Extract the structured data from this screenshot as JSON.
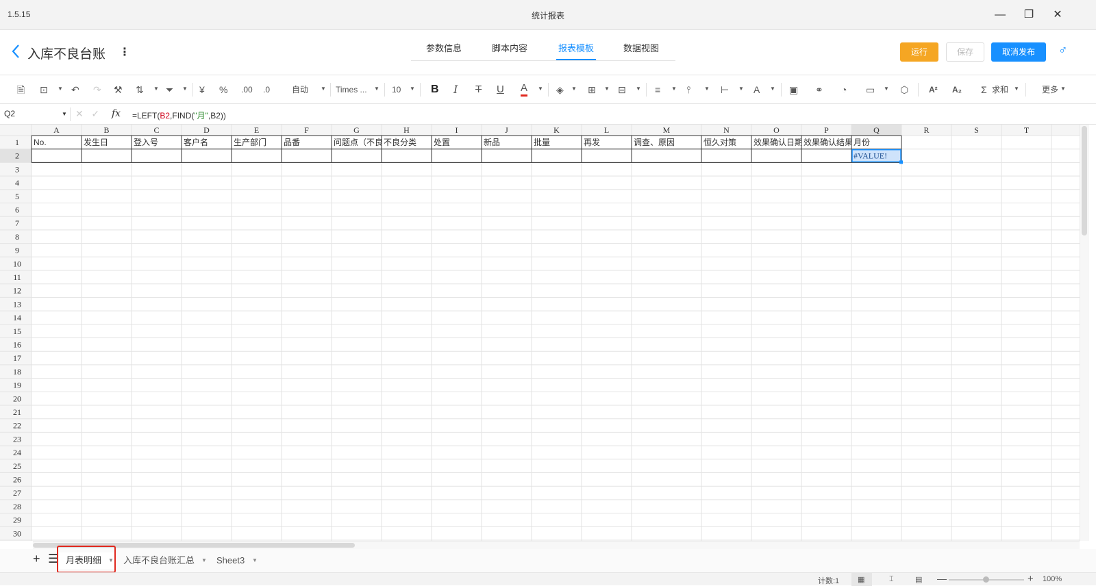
{
  "window": {
    "version": "1.5.15",
    "title": "统计报表",
    "minimize_icon": "minimize-icon",
    "restore_icon": "restore-icon",
    "close_icon": "close-icon"
  },
  "header": {
    "title": "入库不良台账",
    "more_glyph": "⋮",
    "tabs": [
      "参数信息",
      "脚本内容",
      "报表模板",
      "数据视图"
    ],
    "active_tab": "报表模板",
    "buttons": {
      "run": "运行",
      "save": "保存",
      "unpublish": "取消发布"
    },
    "accent": "#1890ff",
    "run_color": "#f5a623"
  },
  "toolbar": {
    "format": "自动",
    "font": "Times ...",
    "size": "10",
    "bold": "B",
    "italic": "I",
    "strike": "T",
    "underline": "U",
    "color_a": "A",
    "currency": "¥",
    "percent": "%",
    "dec_less": ".00",
    "dec_more": ".0",
    "sup": "A²",
    "sub": "A₂",
    "sum": "求和",
    "more": "更多",
    "sum_sigma": "Σ",
    "align_text": "A"
  },
  "formula_bar": {
    "cell_ref": "Q2",
    "fx": "fx",
    "formula_parts": [
      "=LEFT(",
      "B2",
      ",FIND(",
      "\"月\"",
      ",B2))"
    ]
  },
  "grid": {
    "columns": [
      "A",
      "B",
      "C",
      "D",
      "E",
      "F",
      "G",
      "H",
      "I",
      "J",
      "K",
      "L",
      "M",
      "N",
      "O",
      "P",
      "Q",
      "R",
      "S",
      "T"
    ],
    "row_count": 30,
    "header_row": [
      "No.",
      "发生日",
      "登入号",
      "客户名",
      "生产部门",
      "品番",
      "问题点（不良",
      "不良分类",
      "处置",
      "新品",
      "批量",
      "再发",
      "调查、原因",
      "恒久对策",
      "效果确认日期",
      "效果确认结果",
      "月份",
      "",
      "",
      ""
    ],
    "row2": [
      "",
      "",
      "",
      "",
      "",
      "",
      "",
      "",
      "",
      "",
      "",
      "",
      "",
      "",
      "",
      "",
      "#VALUE!",
      "",
      "",
      ""
    ],
    "selected_cell": "Q2"
  },
  "sheets": {
    "tabs": [
      "月表明细",
      "入库不良台账汇总",
      "Sheet3"
    ],
    "active": "月表明细"
  },
  "status": {
    "count": "计数:1",
    "zoom": "100%"
  }
}
